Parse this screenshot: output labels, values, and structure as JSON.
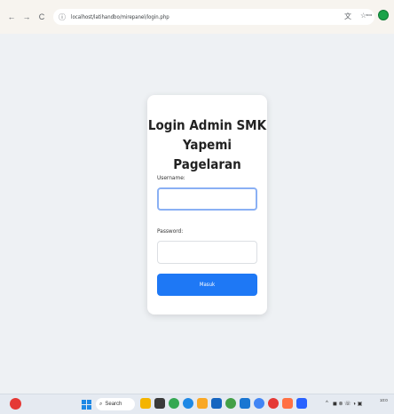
{
  "browser": {
    "back_icon": "←",
    "forward_icon": "→",
    "reload_icon": "C",
    "info_icon": "ⓘ",
    "url": "localhost/latihandbo/mirepanel/login.php",
    "translate_icon": "文",
    "star_icon": "☆",
    "ext_icon": "ꟷ"
  },
  "login": {
    "title_line1": "Login Admin SMK",
    "title_line2": "Yapemi Pagelaran",
    "username_label": "Username:",
    "username_value": "",
    "password_label": "Password:",
    "password_value": "",
    "submit_label": "Masuk"
  },
  "taskbar": {
    "search_label": "Search",
    "search_icon": "⌕",
    "tray_up_icon": "^",
    "tray_icons": "◼ ⊗ ☏ ◑ ▣",
    "clock": "10:0"
  },
  "colors": {
    "primary_button": "#1e78f5",
    "page_background": "#eef1f4",
    "card_background": "#ffffff",
    "focus_outline": "#8ab0f4"
  }
}
